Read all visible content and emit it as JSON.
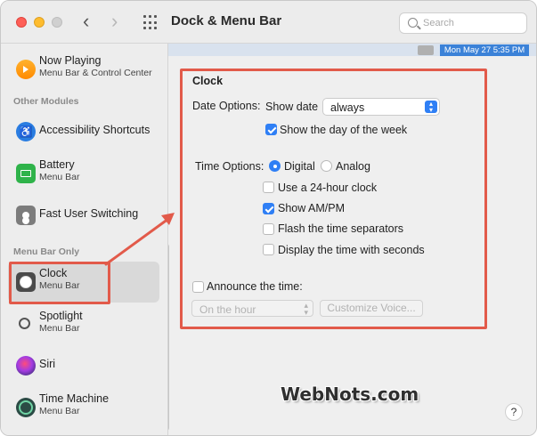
{
  "window": {
    "title": "Dock & Menu Bar"
  },
  "search": {
    "placeholder": "Search"
  },
  "menubar_preview": {
    "clock": "Mon May 27  5:35 PM"
  },
  "sidebar": {
    "items": [
      {
        "label": "Now Playing",
        "sub": "Menu Bar & Control Center",
        "icon": "now-playing-icon"
      },
      {
        "header": "Other Modules"
      },
      {
        "label": "Accessibility Shortcuts",
        "sub": "",
        "icon": "accessibility-icon"
      },
      {
        "label": "Battery",
        "sub": "Menu Bar",
        "icon": "battery-icon"
      },
      {
        "label": "Fast User Switching",
        "sub": "",
        "icon": "fast-user-switching-icon"
      },
      {
        "header": "Menu Bar Only"
      },
      {
        "label": "Clock",
        "sub": "Menu Bar",
        "icon": "clock-icon",
        "selected": true
      },
      {
        "label": "Spotlight",
        "sub": "Menu Bar",
        "icon": "spotlight-icon"
      },
      {
        "label": "Siri",
        "sub": "",
        "icon": "siri-icon"
      },
      {
        "label": "Time Machine",
        "sub": "Menu Bar",
        "icon": "time-machine-icon"
      }
    ]
  },
  "clock": {
    "title": "Clock",
    "date_options_label": "Date Options:",
    "show_date_label": "Show date",
    "show_date_value": "always",
    "show_day_of_week": {
      "label": "Show the day of the week",
      "checked": true
    },
    "time_options_label": "Time Options:",
    "digital_label": "Digital",
    "analog_label": "Analog",
    "time_format_selected": "Digital",
    "use_24_hour": {
      "label": "Use a 24-hour clock",
      "checked": false
    },
    "show_am_pm": {
      "label": "Show AM/PM",
      "checked": true
    },
    "flash_separators": {
      "label": "Flash the time separators",
      "checked": false
    },
    "display_seconds": {
      "label": "Display the time with seconds",
      "checked": false
    },
    "announce": {
      "label": "Announce the time:",
      "checked": false
    },
    "announce_interval": "On the hour",
    "customize_voice": "Customize Voice..."
  },
  "watermark": "WebNots.com",
  "help": "?",
  "colors": {
    "highlight": "#e25a4a",
    "accent": "#2f7ff5"
  }
}
